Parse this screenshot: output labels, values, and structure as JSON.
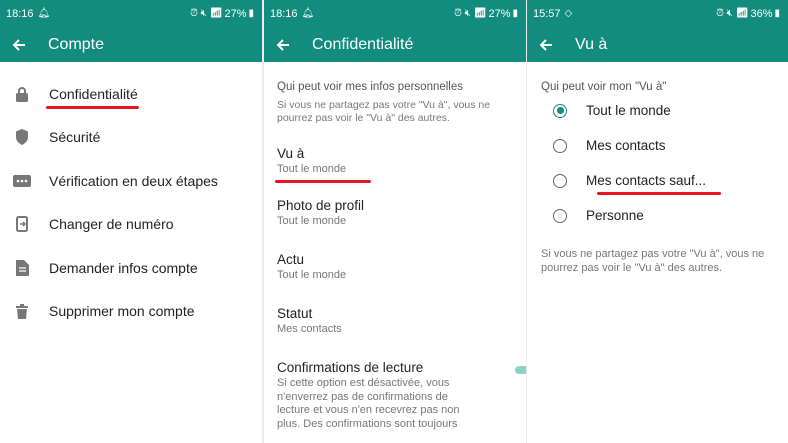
{
  "screen1": {
    "status": {
      "time": "18:16",
      "battery": "27%"
    },
    "title": "Compte",
    "items": [
      {
        "label": "Confidentialité",
        "icon": "lock-icon"
      },
      {
        "label": "Sécurité",
        "icon": "shield-icon"
      },
      {
        "label": "Vérification en deux étapes",
        "icon": "dots-icon"
      },
      {
        "label": "Changer de numéro",
        "icon": "phone-change-icon"
      },
      {
        "label": "Demander infos compte",
        "icon": "document-icon"
      },
      {
        "label": "Supprimer mon compte",
        "icon": "trash-icon"
      }
    ]
  },
  "screen2": {
    "status": {
      "time": "18:16",
      "battery": "27%"
    },
    "title": "Confidentialité",
    "section_title": "Qui peut voir mes infos personnelles",
    "section_note": "Si vous ne partagez pas votre \"Vu à\", vous ne pourrez pas voir le \"Vu à\" des autres.",
    "rows": [
      {
        "title": "Vu à",
        "sub": "Tout le monde"
      },
      {
        "title": "Photo de profil",
        "sub": "Tout le monde"
      },
      {
        "title": "Actu",
        "sub": "Tout le monde"
      },
      {
        "title": "Statut",
        "sub": "Mes contacts"
      },
      {
        "title": "Confirmations de lecture",
        "sub": "Si cette option est désactivée, vous n'enverrez pas de confirmations de lecture et vous n'en recevrez pas non plus. Des confirmations sont toujours"
      }
    ],
    "read_receipts_enabled": true
  },
  "screen3": {
    "status": {
      "time": "15:57",
      "battery": "36%"
    },
    "title": "Vu à",
    "section_title": "Qui peut voir mon \"Vu à\"",
    "options": [
      {
        "label": "Tout le monde",
        "selected": true
      },
      {
        "label": "Mes contacts",
        "selected": false
      },
      {
        "label": "Mes contacts sauf...",
        "selected": false
      },
      {
        "label": "Personne",
        "selected": false
      }
    ],
    "note": "Si vous ne partagez pas votre \"Vu à\", vous ne pourrez pas voir le \"Vu à\" des autres."
  },
  "colors": {
    "brand": "#128c7e",
    "annotation": "#e8171f"
  }
}
